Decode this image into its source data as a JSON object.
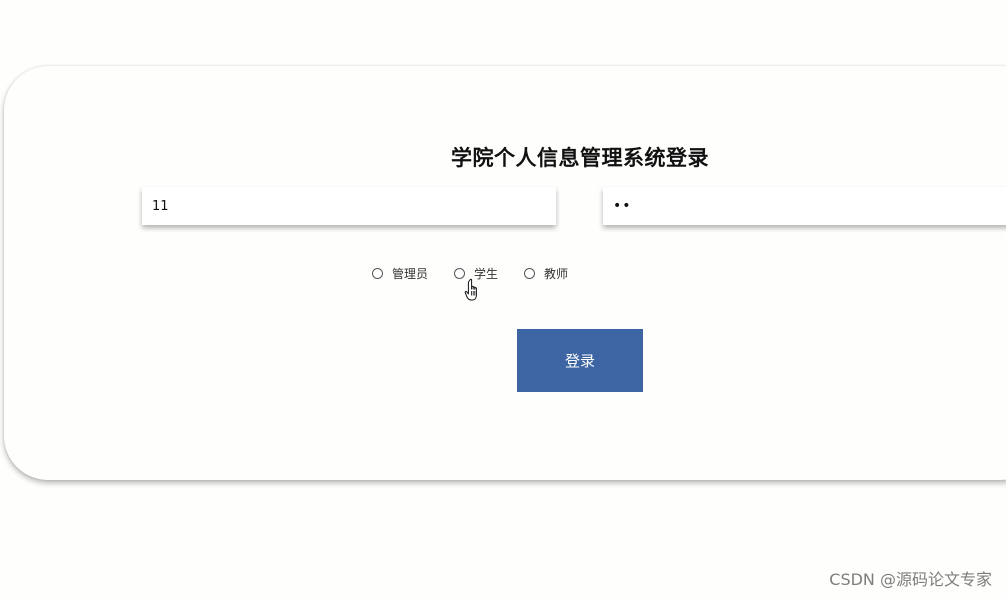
{
  "login": {
    "title": "学院个人信息管理系统登录",
    "username_value": "11",
    "password_value": "••",
    "roles": [
      {
        "label": "管理员"
      },
      {
        "label": "学生"
      },
      {
        "label": "教师"
      }
    ],
    "submit_label": "登录"
  },
  "watermark": {
    "text": "CSDN @源码论文专家"
  },
  "colors": {
    "button": "#3e65a3",
    "background": "#fefefc"
  },
  "icons": {
    "cursor": "hand-pointer-icon"
  }
}
